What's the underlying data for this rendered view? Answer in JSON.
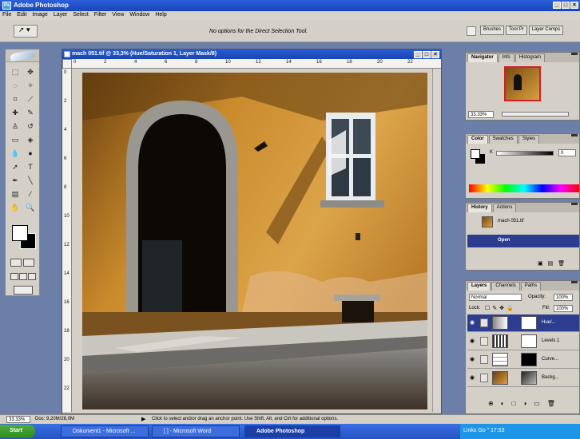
{
  "app": {
    "title": "Adobe Photoshop"
  },
  "menu": [
    "File",
    "Edit",
    "Image",
    "Layer",
    "Select",
    "Filter",
    "View",
    "Window",
    "Help"
  ],
  "options": {
    "message": "No options for the Direct Selection Tool.",
    "palette_well": [
      "Brushes",
      "Tool Pr",
      "Layer Comps"
    ]
  },
  "document": {
    "title": "mach 051.tif @ 33,3% (Hue/Saturation 1, Layer Mask/8)",
    "ruler_top": [
      "0",
      "2",
      "4",
      "6",
      "8",
      "10",
      "12",
      "14",
      "16",
      "18",
      "20",
      "22"
    ],
    "ruler_left": [
      "0",
      "2",
      "4",
      "6",
      "8",
      "10",
      "12",
      "14",
      "16",
      "18",
      "20",
      "22"
    ]
  },
  "navigator": {
    "tabs": [
      "Navigator",
      "Info",
      "Histogram"
    ],
    "zoom": "33.33%"
  },
  "color_panel": {
    "tabs": [
      "Color",
      "Swatches",
      "Styles"
    ],
    "k_label": "K",
    "k_value": "0"
  },
  "history": {
    "tabs": [
      "History",
      "Actions"
    ],
    "snapshot": "mach 051.tif",
    "step": "Open"
  },
  "layers": {
    "tabs": [
      "Layers",
      "Channels",
      "Paths"
    ],
    "blend_mode": "Normal",
    "opacity_label": "Opacity:",
    "opacity": "100%",
    "lock_label": "Lock:",
    "fill_label": "Fill:",
    "fill": "100%",
    "rows": [
      {
        "name": "Hue/...",
        "selected": true
      },
      {
        "name": "Levels 1",
        "selected": false
      },
      {
        "name": "Curve...",
        "selected": false
      },
      {
        "name": "Backg...",
        "selected": false
      }
    ]
  },
  "status": {
    "zoom": "33.33%",
    "doc": "Doc: 9,20M/26,0M",
    "hint": "Click to select and/or drag an anchor point.  Use Shift, Alt, and Ctrl for additional options."
  },
  "taskbar": {
    "start": "Start",
    "tasks": [
      "Dokument1 - Microsoft ...",
      "[ ] - Microsoft Word",
      "Adobe Photoshop"
    ],
    "tray": "Links  Go  \"  17:53"
  }
}
